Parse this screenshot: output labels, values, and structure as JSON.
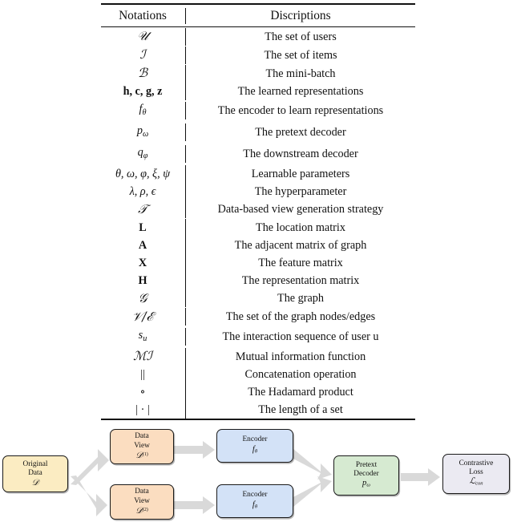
{
  "table": {
    "headers": {
      "notations": "Notations",
      "descriptions": "Discriptions"
    },
    "rows": [
      {
        "symbol": "U",
        "style": "cal",
        "desc": "The set of users"
      },
      {
        "symbol": "I",
        "style": "cal",
        "desc": "The set of items"
      },
      {
        "symbol": "B",
        "style": "cal",
        "desc": "The mini-batch"
      },
      {
        "symbol": "h, c, g, z",
        "style": "bold",
        "desc": "The learned representations"
      },
      {
        "symbol": "f_θ",
        "style": "italsub",
        "desc": "The encoder to learn representations"
      },
      {
        "symbol": "p_ω",
        "style": "italsub",
        "desc": "The pretext decoder"
      },
      {
        "symbol": "q_φ",
        "style": "italsub",
        "desc": "The downstream decoder"
      },
      {
        "symbol": "θ, ω, φ, ξ, ψ",
        "style": "greek",
        "desc": "Learnable parameters"
      },
      {
        "symbol": "λ, ρ, ϵ",
        "style": "greek",
        "desc": "The hyperparameter"
      },
      {
        "symbol": "T",
        "style": "cal",
        "desc": "Data-based view generation strategy"
      },
      {
        "symbol": "L",
        "style": "bold",
        "desc": "The location matrix"
      },
      {
        "symbol": "A",
        "style": "bold",
        "desc": "The adjacent matrix of graph"
      },
      {
        "symbol": "X",
        "style": "bold",
        "desc": "The feature matrix"
      },
      {
        "symbol": "H",
        "style": "bold",
        "desc": "The representation matrix"
      },
      {
        "symbol": "G",
        "style": "cal",
        "desc": "The graph"
      },
      {
        "symbol": "V/E",
        "style": "cal",
        "desc": "The set of the graph nodes/edges"
      },
      {
        "symbol": "s_u",
        "style": "italsub",
        "desc": "The interaction sequence of user u"
      },
      {
        "symbol": "MI",
        "style": "cal",
        "desc": "Mutual information function"
      },
      {
        "symbol": "||",
        "style": "plain",
        "desc": "Concatenation operation"
      },
      {
        "symbol": "∘",
        "style": "plain",
        "desc": "The Hadamard product"
      },
      {
        "symbol": "| · |",
        "style": "plain",
        "desc": "The length of a set"
      }
    ]
  },
  "pipeline": {
    "nodes": [
      {
        "id": "original-data",
        "line1": "Original",
        "line2": "Data",
        "math": "D",
        "sup": "",
        "sub": "",
        "color": "#fbecc2"
      },
      {
        "id": "data-view-1",
        "line1": "Data",
        "line2": "View",
        "math": "D",
        "sup": "(1)",
        "sub": "",
        "color": "#fbddc0"
      },
      {
        "id": "data-view-2",
        "line1": "Data",
        "line2": "View",
        "math": "D",
        "sup": "(2)",
        "sub": "",
        "color": "#fbddc0"
      },
      {
        "id": "encoder-1",
        "line1": "Encoder",
        "line2": "",
        "math": "f",
        "sup": "",
        "sub": "θ",
        "color": "#d3e2f7"
      },
      {
        "id": "encoder-2",
        "line1": "Encoder",
        "line2": "",
        "math": "f",
        "sup": "",
        "sub": "θ",
        "color": "#d3e2f7"
      },
      {
        "id": "pretext-decoder",
        "line1": "Pretext",
        "line2": "Decoder",
        "math": "p",
        "sup": "",
        "sub": "ω",
        "color": "#d6ead1"
      },
      {
        "id": "contrastive-loss",
        "line1": "Contrastive",
        "line2": "Loss",
        "math": "L",
        "sup": "",
        "sub": "con",
        "color": "#ebeaf2"
      }
    ],
    "arrow_color": "#d7d7d7"
  }
}
